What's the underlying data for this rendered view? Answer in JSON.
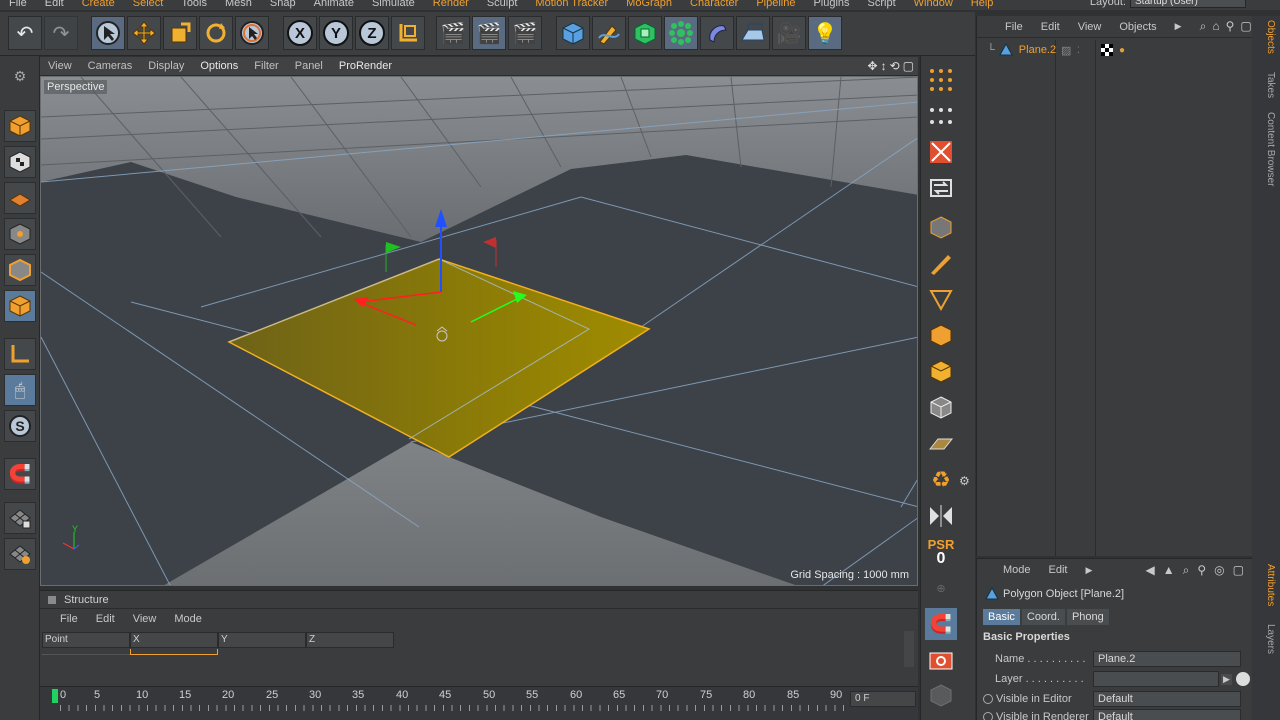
{
  "menubar": {
    "items": [
      {
        "label": "File",
        "hl": false
      },
      {
        "label": "Edit",
        "hl": false
      },
      {
        "label": "Create",
        "hl": true
      },
      {
        "label": "Select",
        "hl": true
      },
      {
        "label": "Tools",
        "hl": false
      },
      {
        "label": "Mesh",
        "hl": false
      },
      {
        "label": "Snap",
        "hl": false
      },
      {
        "label": "Animate",
        "hl": false
      },
      {
        "label": "Simulate",
        "hl": false
      },
      {
        "label": "Render",
        "hl": true
      },
      {
        "label": "Sculpt",
        "hl": false
      },
      {
        "label": "Motion Tracker",
        "hl": true
      },
      {
        "label": "MoGraph",
        "hl": true
      },
      {
        "label": "Character",
        "hl": true
      },
      {
        "label": "Pipeline",
        "hl": true
      },
      {
        "label": "Plugins",
        "hl": false
      },
      {
        "label": "Script",
        "hl": false
      },
      {
        "label": "Window",
        "hl": true
      },
      {
        "label": "Help",
        "hl": true
      }
    ],
    "layout_label": "Layout:",
    "layout_value": "Startup (User)"
  },
  "toolbar": {
    "undo_icon": "undo-icon",
    "axis_x": "X",
    "axis_y": "Y",
    "axis_z": "Z"
  },
  "viewport": {
    "menu": [
      "View",
      "Cameras",
      "Display",
      "Options",
      "Filter",
      "Panel",
      "ProRender"
    ],
    "camera_label": "Perspective",
    "grid_spacing": "Grid Spacing : 1000 mm",
    "axis_y": "Y"
  },
  "righttools": {
    "psr_label": "PSR",
    "psr_value": "0"
  },
  "structure": {
    "title": "Structure",
    "menu": [
      "File",
      "Edit",
      "View",
      "Mode"
    ],
    "columns": [
      "Point",
      "X",
      "Y",
      "Z"
    ]
  },
  "timeline": {
    "ticks": [
      "0",
      "5",
      "10",
      "15",
      "20",
      "25",
      "30",
      "35",
      "40",
      "45",
      "50",
      "55",
      "60",
      "65",
      "70",
      "75",
      "80",
      "85",
      "90"
    ],
    "current_frame": "0 F"
  },
  "objects": {
    "menu": [
      "File",
      "Edit",
      "View",
      "Objects"
    ],
    "items": [
      {
        "name": "Plane.2"
      }
    ]
  },
  "vtabs": {
    "objects": "Objects",
    "takes": "Takes",
    "content_browser": "Content Browser",
    "attributes": "Attributes",
    "layers": "Layers"
  },
  "attributes": {
    "menu": [
      "Mode",
      "Edit"
    ],
    "object_title": "Polygon Object [Plane.2]",
    "tabs": [
      {
        "label": "Basic",
        "selected": true
      },
      {
        "label": "Coord.",
        "selected": false
      },
      {
        "label": "Phong",
        "selected": false
      }
    ],
    "section": "Basic Properties",
    "props": [
      {
        "label": "Name . . . . . . . . . .",
        "value": "Plane.2"
      },
      {
        "label": "Layer . . . . . . . . . .",
        "value": ""
      },
      {
        "label": "Visible in Editor",
        "value": "Default"
      },
      {
        "label": "Visible in Renderer",
        "value": "Default"
      }
    ]
  }
}
